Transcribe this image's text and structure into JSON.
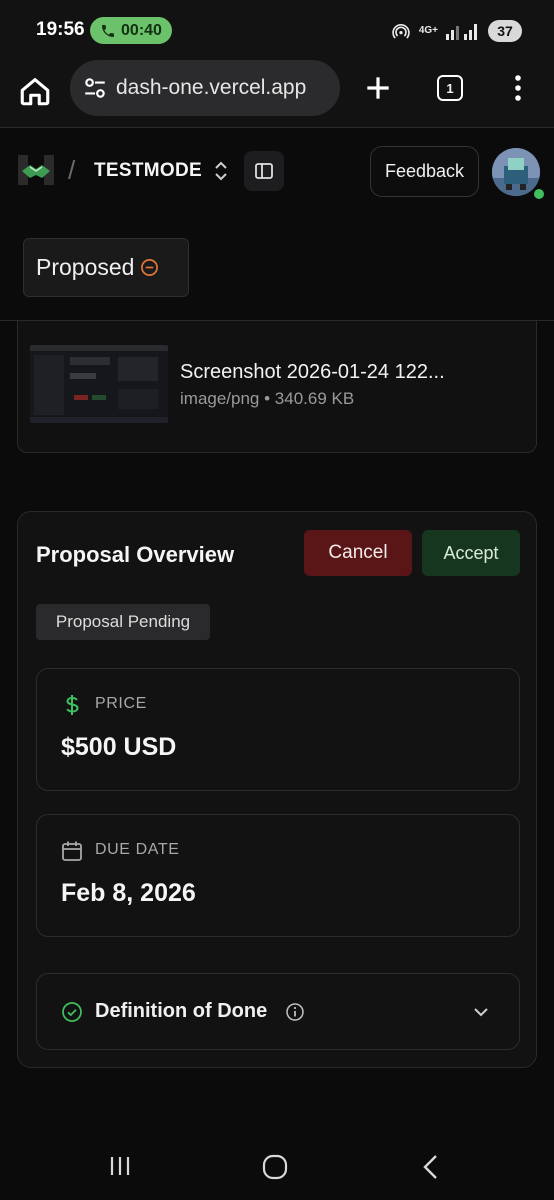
{
  "status_bar": {
    "time": "19:56",
    "call_timer": "00:40",
    "network": "4G+",
    "battery": "37"
  },
  "browser": {
    "url": "dash-one.vercel.app",
    "tab_count": "1"
  },
  "header": {
    "workspace": "TESTMODE",
    "feedback_label": "Feedback"
  },
  "status_chip": {
    "label": "Proposed",
    "accent": "#e2763a"
  },
  "attachment": {
    "file_name": "Screenshot 2026-01-24 122...",
    "file_meta": "image/png • 340.69 KB"
  },
  "proposal": {
    "title": "Proposal Overview",
    "cancel_label": "Cancel",
    "accept_label": "Accept",
    "badge": "Proposal Pending",
    "price_label": "PRICE",
    "price_value": "$500 USD",
    "due_label": "DUE DATE",
    "due_value": "Feb 8, 2026",
    "done_label": "Definition of Done",
    "accent_green": "#3fbf5e",
    "cancel_bg": "#5a1616",
    "accept_bg": "#17361f"
  }
}
